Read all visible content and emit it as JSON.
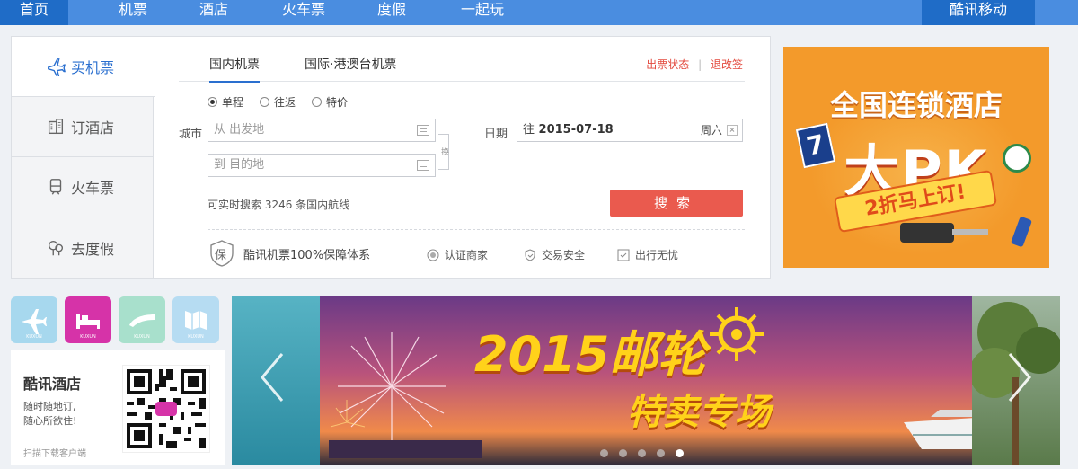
{
  "nav": {
    "items": [
      "首页",
      "机票",
      "酒店",
      "火车票",
      "度假",
      "一起玩"
    ],
    "active_index": 0,
    "mobile": "酷讯移动"
  },
  "sidebar": {
    "items": [
      {
        "label": "买机票",
        "icon": "plane-icon",
        "active": true
      },
      {
        "label": "订酒店",
        "icon": "hotel-icon",
        "active": false
      },
      {
        "label": "火车票",
        "icon": "train-icon",
        "active": false
      },
      {
        "label": "去度假",
        "icon": "vacation-icon",
        "active": false
      }
    ]
  },
  "search": {
    "tabs": [
      "国内机票",
      "国际·港澳台机票"
    ],
    "active_tab": 0,
    "links": [
      "出票状态",
      "退改签"
    ],
    "link_sep": "|",
    "trip_types": [
      "单程",
      "往返",
      "特价"
    ],
    "selected_trip": 0,
    "city_label": "城市",
    "from_placeholder": "从 出发地",
    "to_placeholder": "到 目的地",
    "swap_label": "换",
    "date_label": "日期",
    "date_prefix": "往",
    "date_value": "2015-07-18",
    "weekday": "周六",
    "hint": "可实时搜索 3246 条国内航线",
    "button": "搜索"
  },
  "guarantee": {
    "badge": "保",
    "text": "酷讯机票100%保障体系",
    "items": [
      {
        "label": "认证商家",
        "icon": "certified-icon"
      },
      {
        "label": "交易安全",
        "icon": "shield-icon"
      },
      {
        "label": "出行无忧",
        "icon": "check-icon"
      }
    ]
  },
  "ad": {
    "title": "全国连锁酒店",
    "big": "大PK",
    "sub": "2折马上订!",
    "brand_number": "7"
  },
  "apps": [
    {
      "name": "plane-app-icon",
      "color": "#a7d8ee",
      "caption": "KUXUN"
    },
    {
      "name": "hotel-app-icon",
      "color": "#d633a8",
      "caption": "KUXUN"
    },
    {
      "name": "train-app-icon",
      "color": "#a8e0cc",
      "caption": "KUXUN"
    },
    {
      "name": "map-app-icon",
      "color": "#b6dcf2",
      "caption": "KUXUN"
    }
  ],
  "hotel_app": {
    "title": "酷讯酒店",
    "desc1": "随时随地订,",
    "desc2": "随心所欲住!",
    "scan": "扫描下载客户端"
  },
  "banner": {
    "title": "2015邮轮",
    "subtitle": "特卖专场",
    "dots": 5,
    "active_dot": 4
  },
  "colors": {
    "nav_bg": "#4a8de0",
    "nav_active": "#1f6cc7",
    "accent_blue": "#2a6fcf",
    "search_btn": "#ea5a4e",
    "ad_orange": "#f39a2b"
  }
}
